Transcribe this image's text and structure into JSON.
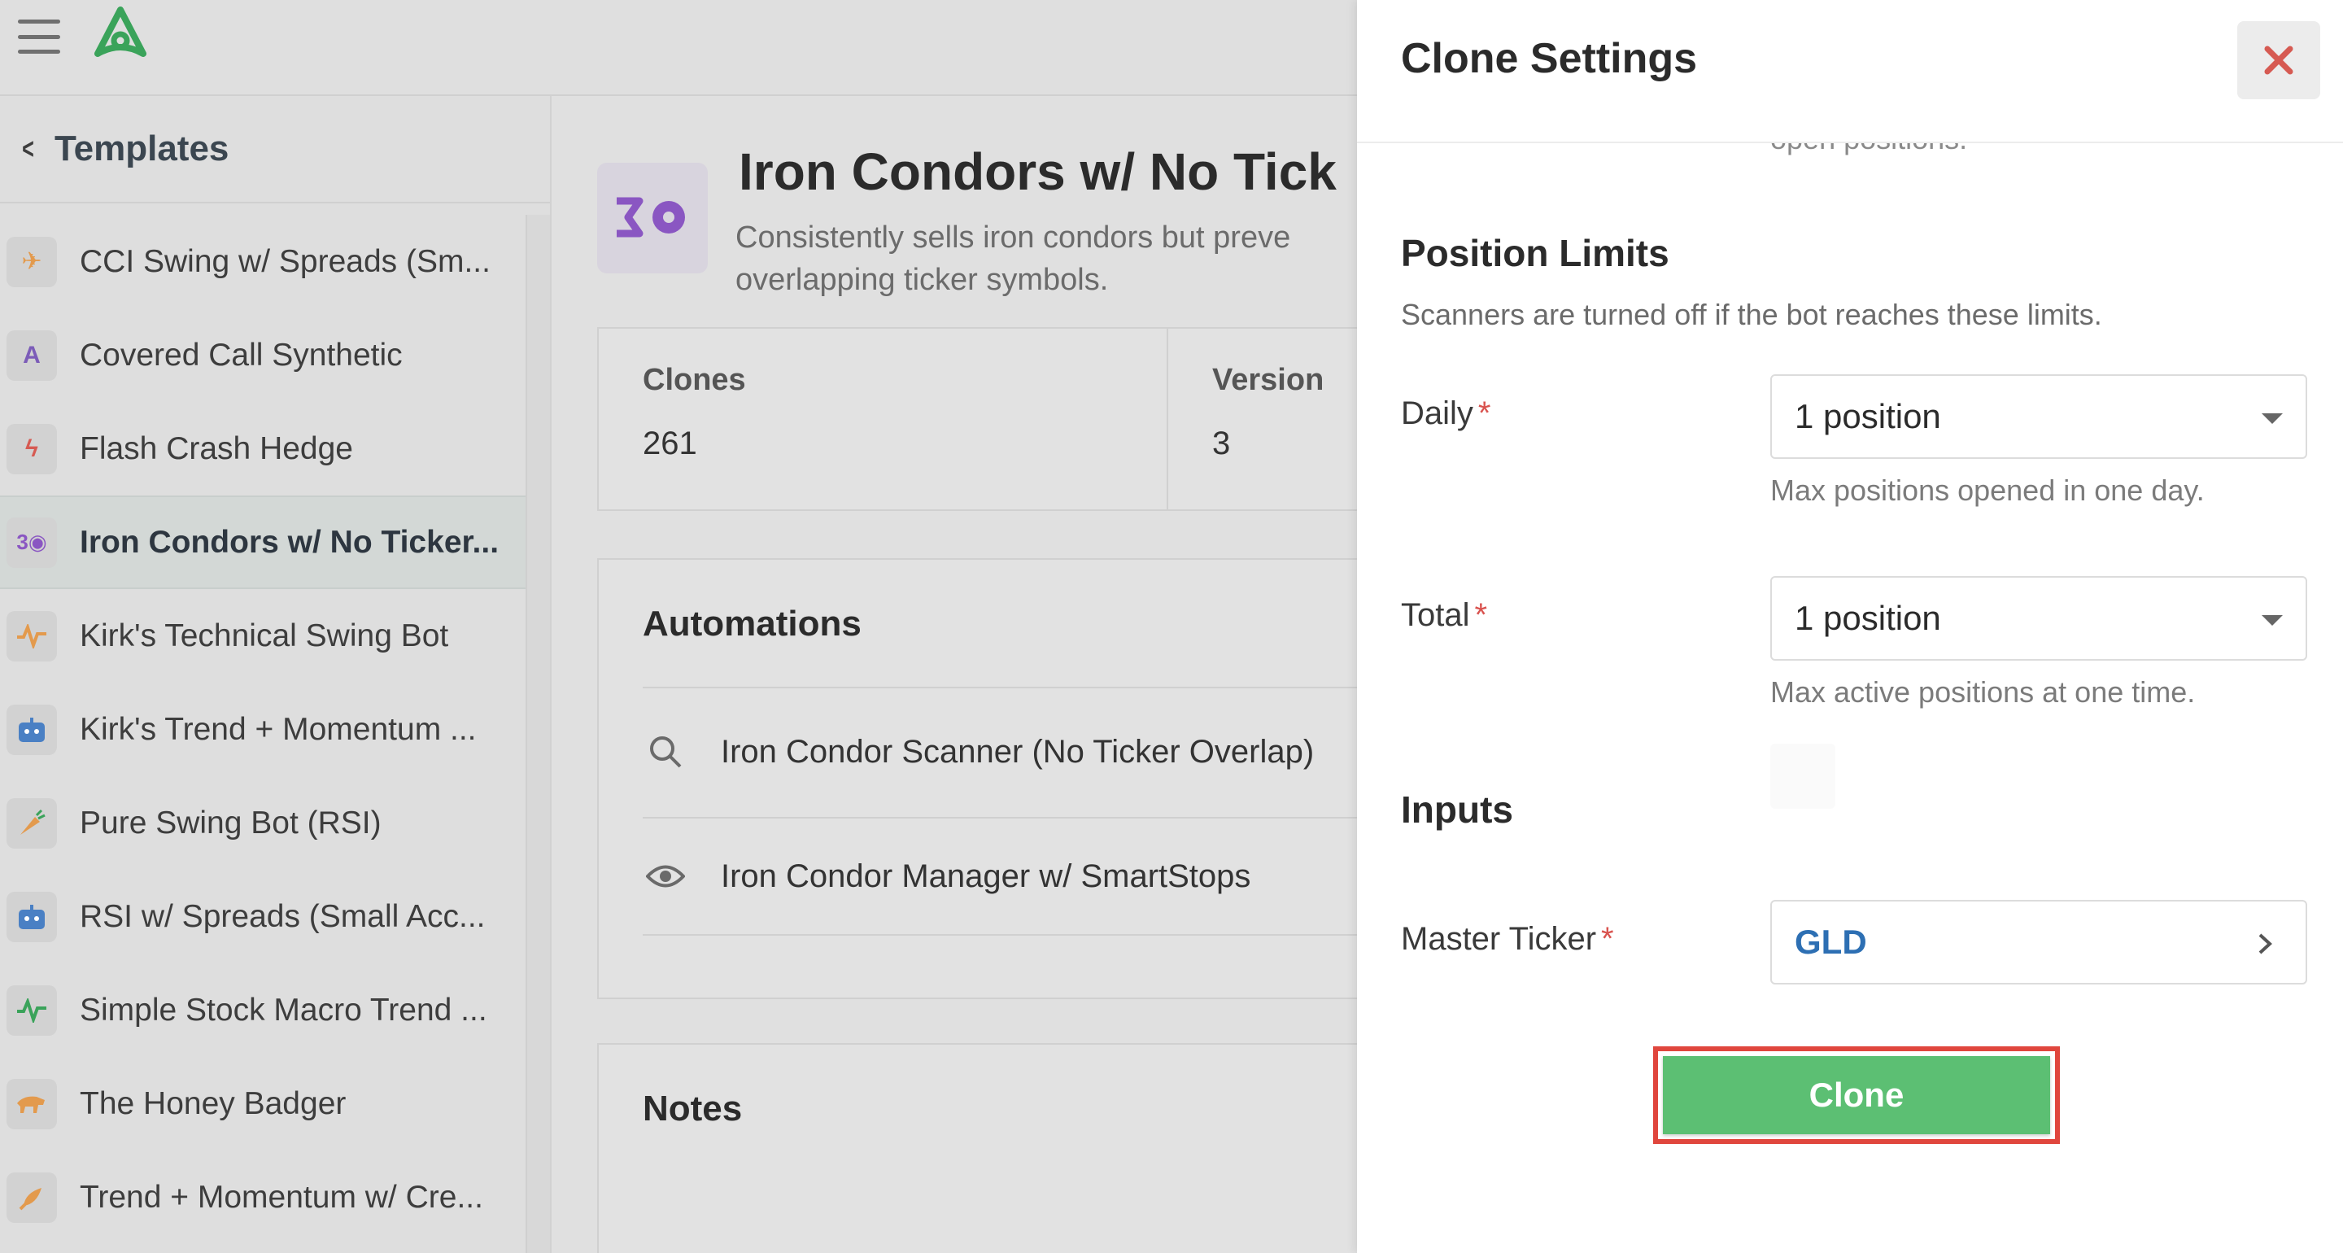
{
  "header": {
    "menu_icon": "hamburger-menu-icon",
    "logo_icon": "app-logo-icon",
    "accent": "#3aa35a"
  },
  "sidebar": {
    "back_label": "Templates",
    "items": [
      {
        "label": "CCI Swing w/ Spreads (Sm...",
        "icon": "airplane-icon",
        "color": "#e39a4d",
        "active": false
      },
      {
        "label": "Covered Call Synthetic",
        "icon": "chart-a-icon",
        "color": "#7c5cb8",
        "active": false
      },
      {
        "label": "Flash Crash Hedge",
        "icon": "lightning-icon",
        "color": "#d65a52",
        "active": false
      },
      {
        "label": "Iron Condors w/ No Ticker...",
        "icon": "iron-condor-icon",
        "color": "#8a56c2",
        "active": true
      },
      {
        "label": "Kirk's Technical Swing Bot",
        "icon": "pulse-icon",
        "color": "#e39a4d",
        "active": false
      },
      {
        "label": "Kirk's Trend + Momentum ...",
        "icon": "robot-icon",
        "color": "#4a80c4",
        "active": false
      },
      {
        "label": "Pure Swing Bot (RSI)",
        "icon": "carrot-icon",
        "color": "#e39a4d",
        "active": false
      },
      {
        "label": "RSI w/ Spreads (Small Acc...",
        "icon": "robot-icon",
        "color": "#4a80c4",
        "active": false
      },
      {
        "label": "Simple Stock Macro Trend ...",
        "icon": "pulse-icon",
        "color": "#3aa35a",
        "active": false
      },
      {
        "label": "The Honey Badger",
        "icon": "badger-icon",
        "color": "#e39a4d",
        "active": false
      },
      {
        "label": "Trend + Momentum w/ Cre...",
        "icon": "rocket-icon",
        "color": "#e39a4d",
        "active": false
      }
    ]
  },
  "template": {
    "title": "Iron Condors w/ No Tick",
    "description": "Consistently sells iron condors but preve overlapping ticker symbols.",
    "icon_color": "#8a56c2",
    "stats": [
      {
        "label": "Clones",
        "value": "261"
      },
      {
        "label": "Version",
        "value": "3"
      }
    ],
    "automations_title": "Automations",
    "automations": [
      {
        "label": "Iron Condor Scanner (No Ticker Overlap)",
        "icon": "search-icon"
      },
      {
        "label": "Iron Condor Manager w/ SmartStops",
        "icon": "eye-icon"
      }
    ],
    "notes_title": "Notes"
  },
  "panel": {
    "title": "Clone Settings",
    "close_icon": "close-icon",
    "truncated_text": "open positions.",
    "position_limits": {
      "title": "Position Limits",
      "description": "Scanners are turned off if the bot reaches these limits.",
      "daily": {
        "label": "Daily",
        "required": "*",
        "value": "1 position",
        "help": "Max positions opened in one day."
      },
      "total": {
        "label": "Total",
        "required": "*",
        "value": "1 position",
        "help": "Max active positions at one time."
      }
    },
    "inputs": {
      "title": "Inputs",
      "master_ticker": {
        "label": "Master Ticker",
        "required": "*",
        "value": "GLD"
      }
    },
    "clone_label": "Clone",
    "colors": {
      "clone_button": "#5cbf73",
      "highlight": "#e0463d",
      "close": "#d65a52",
      "ticker": "#2d6fb3"
    }
  }
}
